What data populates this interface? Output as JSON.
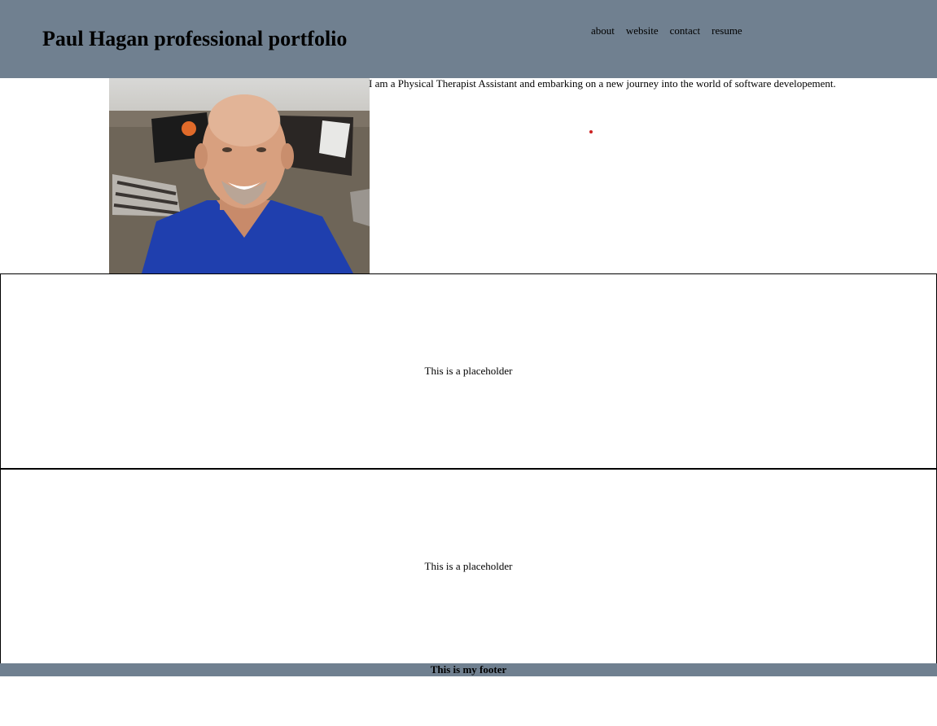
{
  "header": {
    "title": "Paul Hagan professional portfolio",
    "nav": [
      "about",
      "website",
      "contact",
      "resume"
    ]
  },
  "about": {
    "photo_icon": "profile-photo",
    "bio": "I am a Physical Therapist Assistant and embarking on a new journey into the world of software developement."
  },
  "sections": [
    {
      "text": "This is a placeholder"
    },
    {
      "text": "This is a placeholder"
    }
  ],
  "footer": {
    "text": "This is my footer"
  },
  "colors": {
    "header_bg": "#708090",
    "footer_bg": "#708090"
  }
}
